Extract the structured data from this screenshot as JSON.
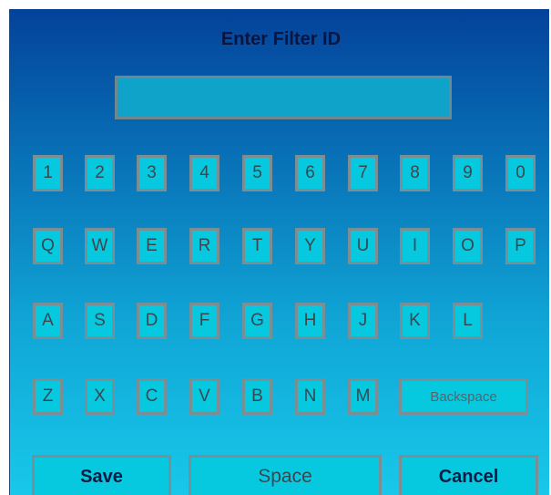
{
  "dialog": {
    "title": "Enter Filter ID",
    "input_value": ""
  },
  "keyboard": {
    "row1": [
      "1",
      "2",
      "3",
      "4",
      "5",
      "6",
      "7",
      "8",
      "9",
      "0"
    ],
    "row2": [
      "Q",
      "W",
      "E",
      "R",
      "T",
      "Y",
      "U",
      "I",
      "O",
      "P"
    ],
    "row3": [
      "A",
      "S",
      "D",
      "F",
      "G",
      "H",
      "J",
      "K",
      "L"
    ],
    "row4": [
      "Z",
      "X",
      "C",
      "V",
      "B",
      "N",
      "M"
    ],
    "backspace_label": "Backspace"
  },
  "actions": {
    "save_label": "Save",
    "space_label": "Space",
    "cancel_label": "Cancel"
  },
  "colors": {
    "gradient_top": "#04429a",
    "gradient_bottom": "#18c8ea",
    "key_fill": "#06c9e0",
    "key_border": "#7a8e95"
  }
}
